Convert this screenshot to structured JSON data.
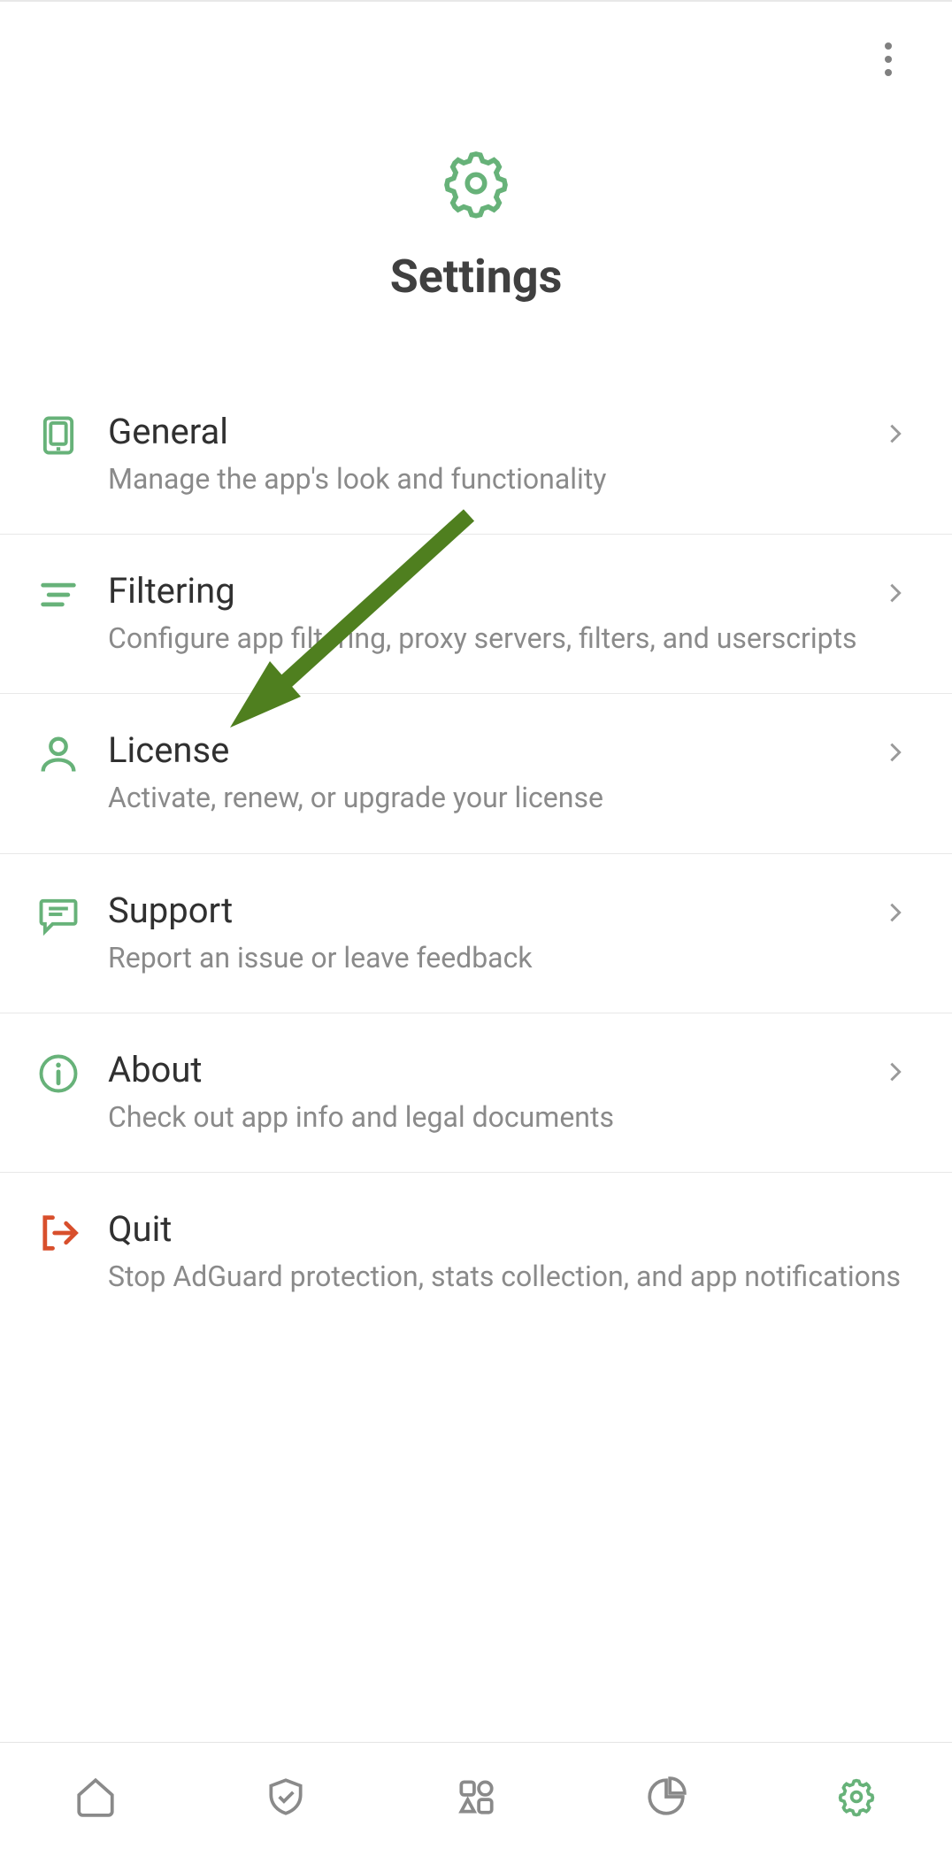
{
  "accent": "#67b279",
  "danger": "#d84f2c",
  "gray": "#8a8a8a",
  "header": {
    "title": "Settings"
  },
  "items": [
    {
      "title": "General",
      "sub": "Manage the app's look and functionality"
    },
    {
      "title": "Filtering",
      "sub": "Configure app filtering, proxy servers, filters, and userscripts"
    },
    {
      "title": "License",
      "sub": "Activate, renew, or upgrade your license"
    },
    {
      "title": "Support",
      "sub": "Report an issue or leave feedback"
    },
    {
      "title": "About",
      "sub": "Check out app info and legal documents"
    },
    {
      "title": "Quit",
      "sub": "Stop AdGuard protection, stats collection, and app notifications"
    }
  ],
  "nav": {
    "home": "Home",
    "protection": "Protection",
    "apps": "Apps",
    "stats": "Statistics",
    "settings": "Settings"
  }
}
